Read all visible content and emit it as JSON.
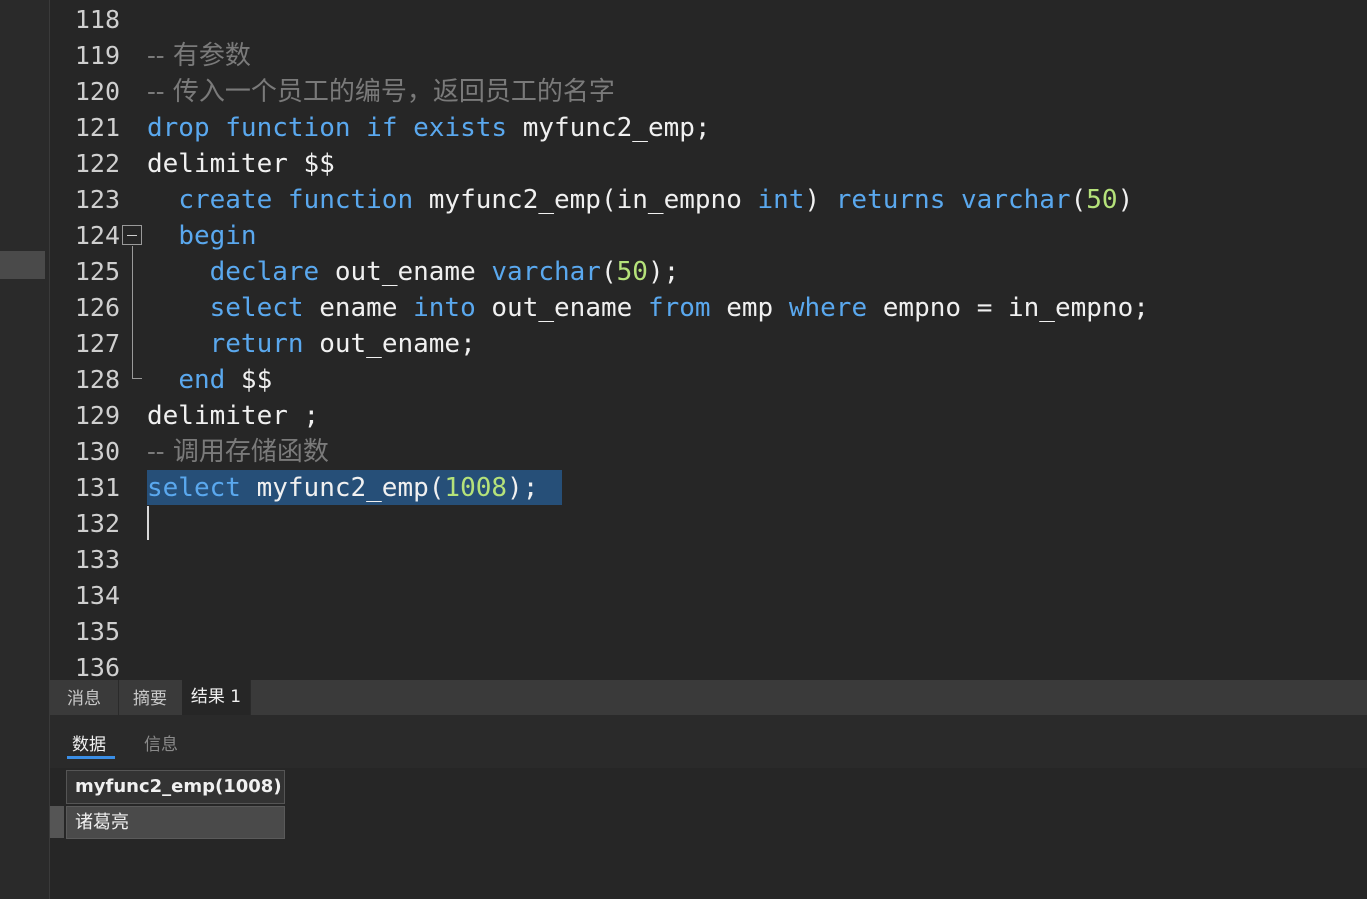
{
  "editor": {
    "line_numbers": [
      "118",
      "119",
      "120",
      "121",
      "122",
      "123",
      "124",
      "125",
      "126",
      "127",
      "128",
      "129",
      "130",
      "131",
      "132",
      "133",
      "134",
      "135",
      "136"
    ],
    "lines": [
      {
        "indent": "",
        "tokens": []
      },
      {
        "indent": "",
        "tokens": [
          {
            "t": "-- 有参数",
            "c": "cm"
          }
        ]
      },
      {
        "indent": "",
        "tokens": [
          {
            "t": "-- 传入一个员工的编号，返回员工的名字",
            "c": "cm"
          }
        ]
      },
      {
        "indent": "",
        "tokens": [
          {
            "t": "drop",
            "c": "kw"
          },
          {
            "t": " ",
            "c": "pl"
          },
          {
            "t": "function",
            "c": "kw"
          },
          {
            "t": " ",
            "c": "pl"
          },
          {
            "t": "if",
            "c": "kw"
          },
          {
            "t": " ",
            "c": "pl"
          },
          {
            "t": "exists",
            "c": "kw"
          },
          {
            "t": " myfunc2_emp;",
            "c": "pl"
          }
        ]
      },
      {
        "indent": "",
        "tokens": [
          {
            "t": "delimiter $$",
            "c": "pl"
          }
        ]
      },
      {
        "indent": "  ",
        "tokens": [
          {
            "t": "create",
            "c": "kw"
          },
          {
            "t": " ",
            "c": "pl"
          },
          {
            "t": "function",
            "c": "kw"
          },
          {
            "t": " myfunc2_emp(in_empno ",
            "c": "pl"
          },
          {
            "t": "int",
            "c": "kw"
          },
          {
            "t": ") ",
            "c": "pl"
          },
          {
            "t": "returns",
            "c": "kw"
          },
          {
            "t": " ",
            "c": "pl"
          },
          {
            "t": "varchar",
            "c": "kw"
          },
          {
            "t": "(",
            "c": "pl"
          },
          {
            "t": "50",
            "c": "num"
          },
          {
            "t": ")",
            "c": "pl"
          }
        ]
      },
      {
        "indent": "  ",
        "tokens": [
          {
            "t": "begin",
            "c": "kw"
          }
        ]
      },
      {
        "indent": "    ",
        "tokens": [
          {
            "t": "declare",
            "c": "kw"
          },
          {
            "t": " out_ename ",
            "c": "pl"
          },
          {
            "t": "varchar",
            "c": "kw"
          },
          {
            "t": "(",
            "c": "pl"
          },
          {
            "t": "50",
            "c": "num"
          },
          {
            "t": ");",
            "c": "pl"
          }
        ]
      },
      {
        "indent": "    ",
        "tokens": [
          {
            "t": "select",
            "c": "kw"
          },
          {
            "t": " ename ",
            "c": "pl"
          },
          {
            "t": "into",
            "c": "kw"
          },
          {
            "t": " out_ename ",
            "c": "pl"
          },
          {
            "t": "from",
            "c": "kw"
          },
          {
            "t": " emp ",
            "c": "pl"
          },
          {
            "t": "where",
            "c": "kw"
          },
          {
            "t": " empno = in_empno;",
            "c": "pl"
          }
        ]
      },
      {
        "indent": "    ",
        "tokens": [
          {
            "t": "return",
            "c": "kw"
          },
          {
            "t": " out_ename;",
            "c": "pl"
          }
        ]
      },
      {
        "indent": "  ",
        "tokens": [
          {
            "t": "end",
            "c": "kw"
          },
          {
            "t": " $$",
            "c": "pl"
          }
        ]
      },
      {
        "indent": "",
        "tokens": [
          {
            "t": "delimiter ;",
            "c": "pl"
          }
        ]
      },
      {
        "indent": "",
        "tokens": [
          {
            "t": "-- 调用存储函数",
            "c": "cm"
          }
        ]
      },
      {
        "indent": "",
        "tokens": [
          {
            "t": "select",
            "c": "kw"
          },
          {
            "t": " myfunc2_emp(",
            "c": "pl"
          },
          {
            "t": "1008",
            "c": "num"
          },
          {
            "t": ");",
            "c": "pl"
          }
        ]
      },
      {
        "indent": "",
        "tokens": []
      },
      {
        "indent": "",
        "tokens": []
      },
      {
        "indent": "",
        "tokens": []
      },
      {
        "indent": "",
        "tokens": []
      },
      {
        "indent": "",
        "tokens": []
      }
    ]
  },
  "result_tabs": [
    {
      "label": "消息",
      "active": false
    },
    {
      "label": "摘要",
      "active": false
    },
    {
      "label": "结果 1",
      "active": true
    }
  ],
  "sub_tabs": [
    {
      "label": "数据",
      "active": true
    },
    {
      "label": "信息",
      "active": false
    }
  ],
  "grid": {
    "column_header": "myfunc2_emp(1008)",
    "rows": [
      "诸葛亮"
    ]
  },
  "colors": {
    "keyword": "#5aa8ee",
    "number": "#b5e27a",
    "comment": "#7a7a7a",
    "selection": "#264f78",
    "accent": "#3a8ee6"
  }
}
